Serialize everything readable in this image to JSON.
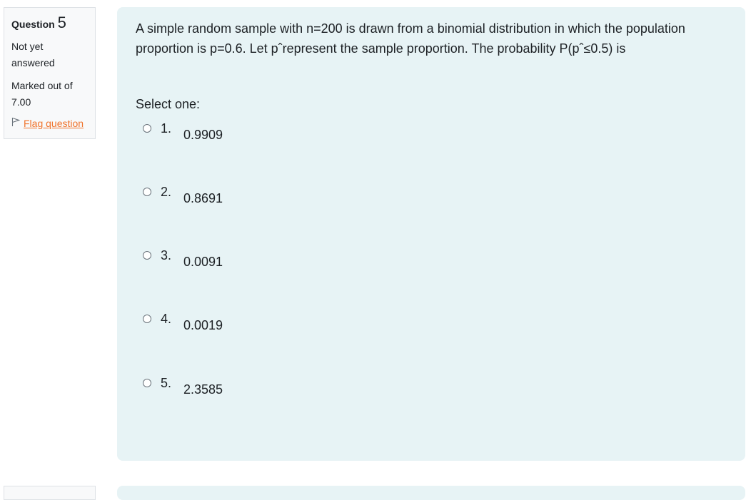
{
  "info": {
    "question_label": "Question",
    "question_number": "5",
    "state": "Not yet answered",
    "grade": "Marked out of 7.00",
    "flag_label": "Flag question"
  },
  "question": {
    "text": "A simple random sample with n=200 is drawn from a binomial distribution in which the population proportion is p=0.6.  Let pˆrepresent the sample proportion. The probability P(pˆ≤0.5) is",
    "prompt": "Select one:",
    "options": [
      {
        "num": "1.",
        "value": "0.9909"
      },
      {
        "num": "2.",
        "value": "0.8691"
      },
      {
        "num": "3.",
        "value": "0.0091"
      },
      {
        "num": "4.",
        "value": "0.0019"
      },
      {
        "num": "5.",
        "value": "2.3585"
      }
    ]
  },
  "colors": {
    "accent_link": "#f0732b",
    "content_bg": "#e7f3f5"
  }
}
